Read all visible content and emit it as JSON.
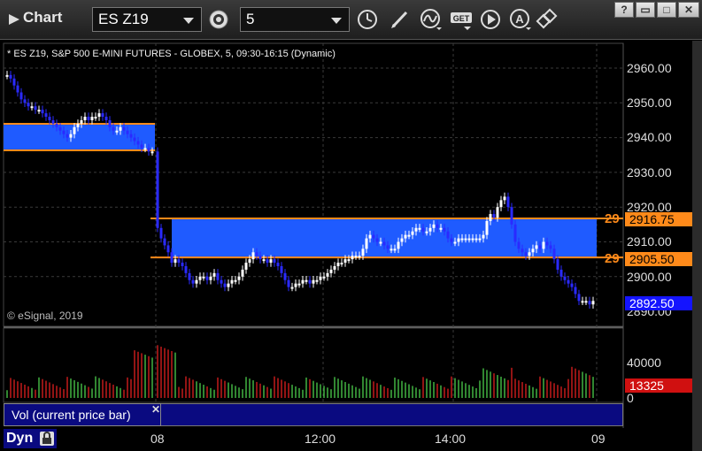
{
  "window": {
    "app_title": "Chart",
    "symbol": "ES Z19",
    "interval": "5",
    "controls": [
      "?",
      "▭",
      "□",
      "✕"
    ]
  },
  "chart": {
    "description": "* ES Z19, S&P 500 E-MINI FUTURES - GLOBEX, 5, 09:30-16:15 (Dynamic)",
    "copyright": "© eSignal, 2019",
    "price_axis": [
      "2960.00",
      "2950.00",
      "2940.00",
      "2930.00",
      "2920.00",
      "2910.00",
      "2900.00",
      "2890.00"
    ],
    "levels": [
      {
        "count": "29",
        "price": "2916.75",
        "color": "#ff8a1a"
      },
      {
        "count": "29",
        "price": "2905.50",
        "color": "#ff8a1a"
      }
    ],
    "last_price": "2892.50",
    "volume_axis": [
      "40000",
      "0"
    ],
    "last_volume": "13325",
    "study_label": "Vol (current price bar)",
    "time_axis": [
      "08",
      "12:00",
      "14:00",
      "09"
    ],
    "dyn_label": "Dyn"
  },
  "colors": {
    "up": "#ffffff",
    "down": "#2a2aff",
    "zone": "#1f5bff",
    "level": "#ff8a1a",
    "vol_up": "#4ccf4c",
    "vol_down": "#e02020",
    "last_price_tag": "#1414ff",
    "last_volume_tag": "#d01010"
  }
}
